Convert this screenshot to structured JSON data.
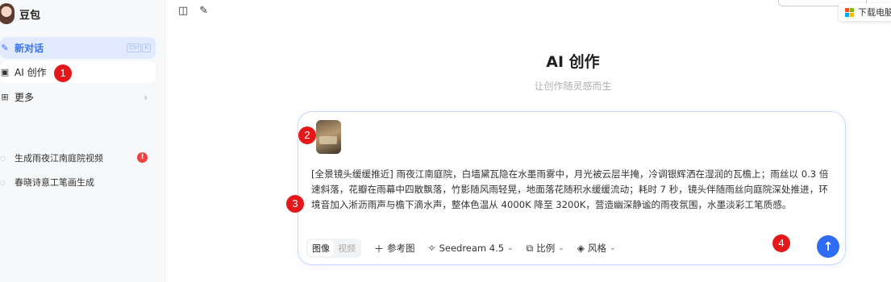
{
  "app": {
    "name": "豆包",
    "avatar": "avatar"
  },
  "sidebar": {
    "new_chat": {
      "label": "新对话",
      "icon": "edit-icon",
      "shortcut": [
        "Ctrl",
        "K"
      ]
    },
    "ai_create": {
      "label": "AI 创作",
      "icon": "image-icon"
    },
    "more": {
      "label": "更多",
      "icon": "grid-icon",
      "chevron": "›"
    },
    "history": [
      {
        "label": "生成雨夜江南庭院视频",
        "badge": "!"
      },
      {
        "label": "春晓诗意工笔画生成"
      }
    ]
  },
  "topbar": {
    "icons": [
      "sidebar-toggle-icon",
      "new-chat-icon"
    ],
    "download_label": "下载电脑"
  },
  "main": {
    "title": "AI 创作",
    "subtitle": "让创作随灵感而生",
    "prompt": "[全景镜头缓缓推近] 雨夜江南庭院，白墙黛瓦隐在水墨雨雾中，月光被云层半掩，冷调银辉洒在湿润的瓦檐上；雨丝以 0.3 倍速斜落，花瓣在雨幕中四散飘落，竹影随风雨轻晃，地面落花随积水缓缓流动；耗时 7 秒，镜头伴随雨丝向庭院深处推进，环境音加入淅沥雨声与檐下滴水声，整体色温从 4000K 降至 3200K，营造幽深静谧的雨夜氛围，水墨淡彩工笔质感。",
    "toolbar": {
      "mode_image": "图像",
      "mode_video": "视频",
      "reference": "参考图",
      "model": "Seedream 4.5",
      "ratio": "比例",
      "style": "风格"
    },
    "send_icon": "arrow-up-icon"
  },
  "markers": [
    "1",
    "2",
    "3",
    "4"
  ],
  "colors": {
    "accent": "#2f6cf6",
    "marker": "#e4181a",
    "badge": "#f04142",
    "active_bg": "#e1eaff"
  }
}
